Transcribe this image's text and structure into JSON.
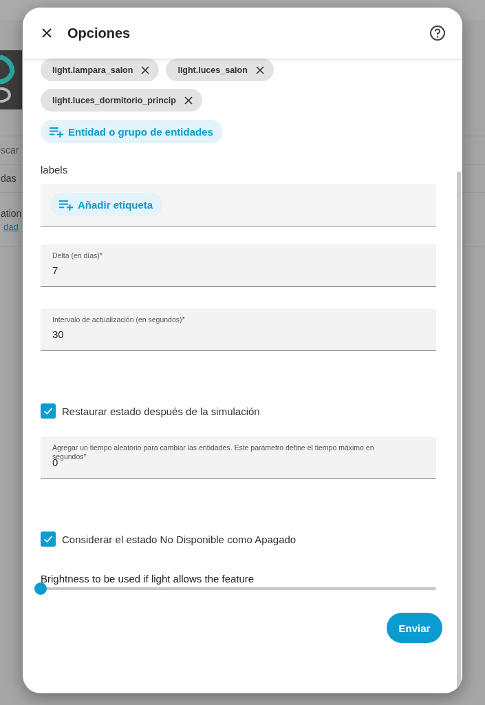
{
  "background": {
    "search_fragment": "scar",
    "row_fragments": [
      "das",
      "ation"
    ],
    "link_fragment": "dad"
  },
  "dialog": {
    "title": "Opciones"
  },
  "entity_chips": [
    {
      "label": "light.lampara_salon"
    },
    {
      "label": "light.luces_salon"
    },
    {
      "label": "light.luces_dormitorio_princip"
    }
  ],
  "add_entity_button": "Entidad o grupo de entidades",
  "labels_title": "labels",
  "add_label_button": "Añadir etiqueta",
  "form": [
    {
      "kind": "field",
      "label": "Delta (en días)*",
      "value": "7"
    },
    {
      "kind": "field",
      "label": "Intervalo de actualización (en segundos)*",
      "value": "30"
    },
    {
      "kind": "checkbox",
      "label": "Restaurar estado después de la simulación",
      "checked": true
    },
    {
      "kind": "field",
      "label": "Agregar un tiempo aleatorio para cambiar las entidades. Este parámetro define el tiempo máximo en segundos*",
      "value": "0"
    },
    {
      "kind": "checkbox",
      "label": "Considerar el estado No Disponible como Apagado",
      "checked": true
    },
    {
      "kind": "slider",
      "label": "Brightness to be used if light allows the feature",
      "level": 0
    }
  ],
  "submit_button": "Enviar"
}
